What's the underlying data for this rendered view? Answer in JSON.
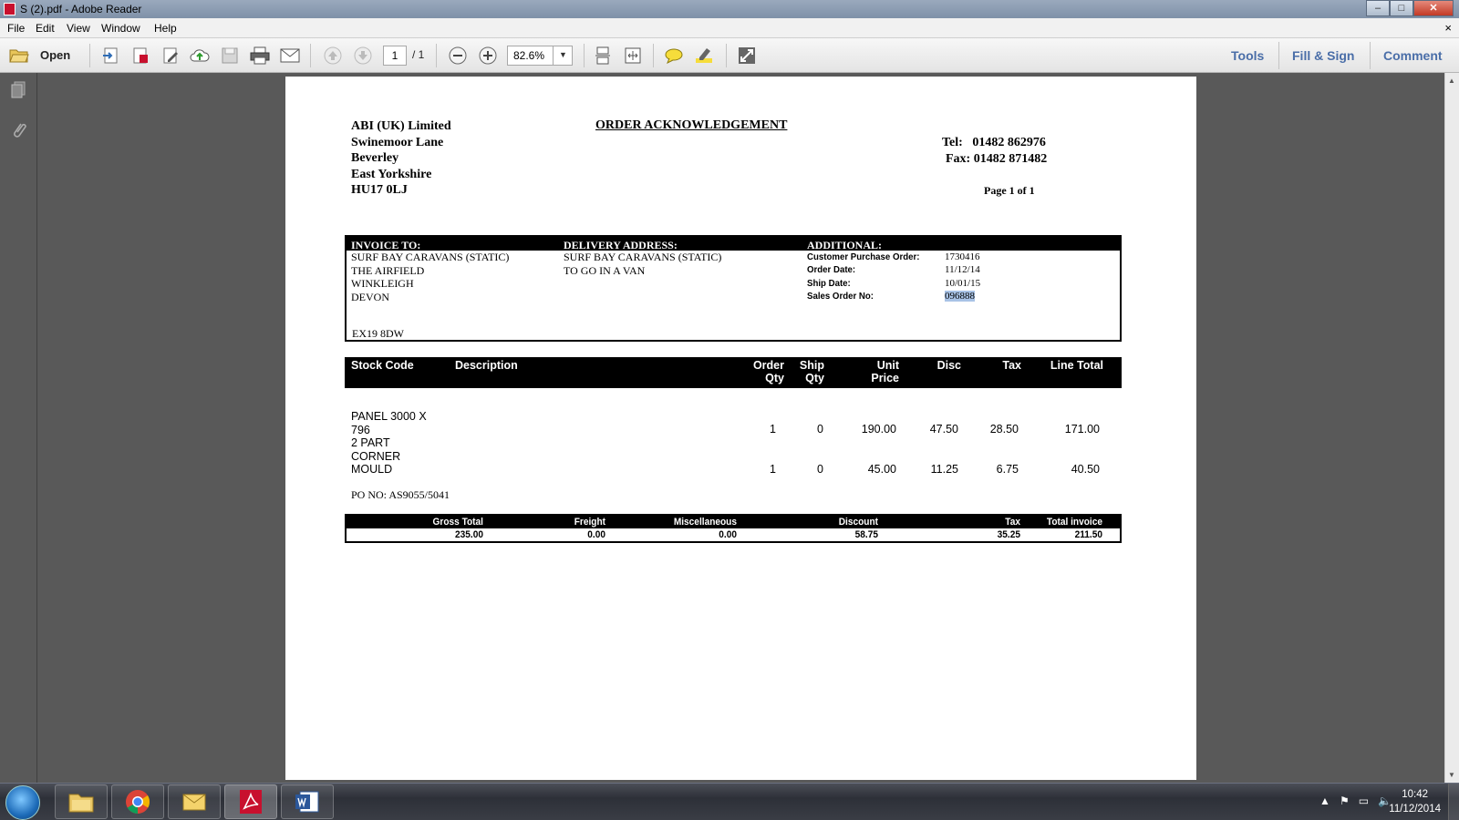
{
  "window": {
    "title": "S (2).pdf - Adobe Reader",
    "minimize": "–",
    "maximize": "□",
    "close": "✕"
  },
  "menu": {
    "items": [
      "File",
      "Edit",
      "View",
      "Window",
      "Help"
    ],
    "close_doc": "×"
  },
  "toolbar": {
    "open_label": "Open",
    "current_page": "1",
    "page_total": "/ 1",
    "zoom": "82.6%",
    "tools_label": "Tools",
    "fill_sign_label": "Fill & Sign",
    "comment_label": "Comment"
  },
  "document": {
    "company": {
      "name": "ABI (UK) Limited",
      "line1": "Swinemoor Lane",
      "line2": "Beverley",
      "line3": "East Yorkshire",
      "postcode": "HU17 0LJ"
    },
    "title": "ORDER ACKNOWLEDGEMENT",
    "tel": "Tel:   01482 862976",
    "fax": "Fax: 01482 871482",
    "page_info": "Page 1 of 1",
    "invoice_to": {
      "heading": "INVOICE TO:",
      "lines": [
        "SURF BAY CARAVANS (STATIC)",
        "THE AIRFIELD",
        "WINKLEIGH",
        "DEVON"
      ],
      "postcode": "EX19 8DW"
    },
    "delivery": {
      "heading": "DELIVERY ADDRESS:",
      "lines": [
        "SURF BAY CARAVANS (STATIC)",
        "TO GO IN A VAN"
      ]
    },
    "additional": {
      "heading": "ADDITIONAL:",
      "customer_po_label": "Customer Purchase Order:",
      "customer_po": "1730416",
      "order_date_label": "Order Date:",
      "order_date": "11/12/14",
      "ship_date_label": "Ship Date:",
      "ship_date": "10/01/15",
      "sales_order_label": "Sales Order No:",
      "sales_order": "096888"
    },
    "columns": {
      "stock_code": "Stock Code",
      "description": "Description",
      "order_qty_1": "Order",
      "order_qty_2": "Qty",
      "ship_qty_1": "Ship",
      "ship_qty_2": "Qty",
      "unit_price_1": "Unit",
      "unit_price_2": "Price",
      "disc": "Disc",
      "tax": "Tax",
      "line_total": "Line Total"
    },
    "items": [
      {
        "stock_lines": [
          "PANEL 3000 X",
          "796"
        ],
        "order_qty": "1",
        "ship_qty": "0",
        "unit_price": "190.00",
        "disc": "47.50",
        "tax": "28.50",
        "line_total": "171.00"
      },
      {
        "stock_lines": [
          "2 PART",
          "CORNER",
          "MOULD"
        ],
        "order_qty": "1",
        "ship_qty": "0",
        "unit_price": "45.00",
        "disc": "11.25",
        "tax": "6.75",
        "line_total": "40.50"
      }
    ],
    "po_no": "PO NO: AS9055/5041",
    "totals": {
      "gross_total_label": "Gross Total",
      "gross_total": "235.00",
      "freight_label": "Freight",
      "freight": "0.00",
      "misc_label": "Miscellaneous",
      "misc": "0.00",
      "discount_label": "Discount",
      "discount": "58.75",
      "tax_label": "Tax",
      "tax": "35.25",
      "total_invoice_label": "Total invoice",
      "total_invoice": "211.50"
    }
  },
  "taskbar": {
    "time": "10:42",
    "date": "11/12/2014"
  },
  "colors": {
    "accent": "#4a6ea8",
    "pdf_red": "#c8102e",
    "doc_background": "#595959"
  }
}
